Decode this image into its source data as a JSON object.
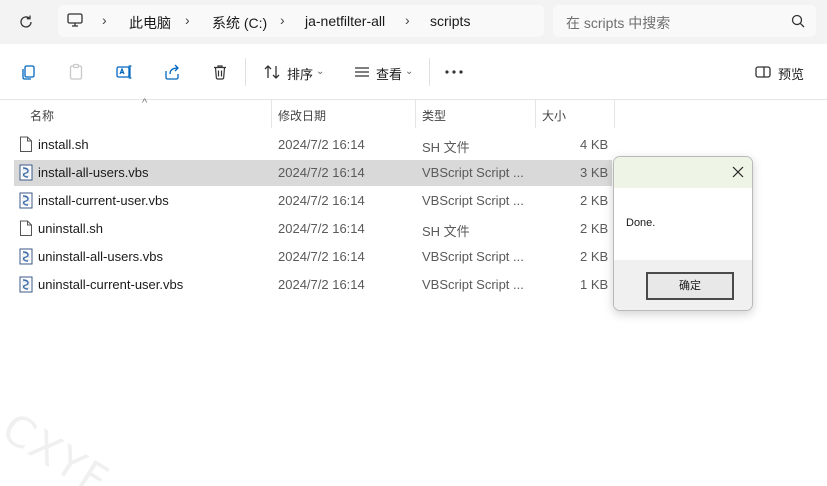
{
  "address_bar": {
    "crumbs": [
      "此电脑",
      "系统 (C:)",
      "ja-netfilter-all",
      "scripts"
    ],
    "search_placeholder": "在 scripts 中搜索"
  },
  "toolbar": {
    "sort_label": "排序",
    "view_label": "查看",
    "preview_label": "预览"
  },
  "columns": {
    "name": "名称",
    "modified": "修改日期",
    "type": "类型",
    "size": "大小"
  },
  "files": [
    {
      "name": "install.sh",
      "modified": "2024/7/2 16:14",
      "type": "SH 文件",
      "size": "4 KB",
      "icon": "document-icon"
    },
    {
      "name": "install-all-users.vbs",
      "modified": "2024/7/2 16:14",
      "type": "VBScript Script ...",
      "size": "3 KB",
      "icon": "vbscript-icon",
      "selected": true
    },
    {
      "name": "install-current-user.vbs",
      "modified": "2024/7/2 16:14",
      "type": "VBScript Script ...",
      "size": "2 KB",
      "icon": "vbscript-icon"
    },
    {
      "name": "uninstall.sh",
      "modified": "2024/7/2 16:14",
      "type": "SH 文件",
      "size": "2 KB",
      "icon": "document-icon"
    },
    {
      "name": "uninstall-all-users.vbs",
      "modified": "2024/7/2 16:14",
      "type": "VBScript Script ...",
      "size": "2 KB",
      "icon": "vbscript-icon"
    },
    {
      "name": "uninstall-current-user.vbs",
      "modified": "2024/7/2 16:14",
      "type": "VBScript Script ...",
      "size": "1 KB",
      "icon": "vbscript-icon"
    }
  ],
  "dialog": {
    "message": "Done.",
    "ok_label": "确定"
  },
  "watermark": "CXYF",
  "colors": {
    "selected_row": "#d9d9d9",
    "dialog_title_bg": "#eef5e6",
    "accent": "#0067c0"
  }
}
